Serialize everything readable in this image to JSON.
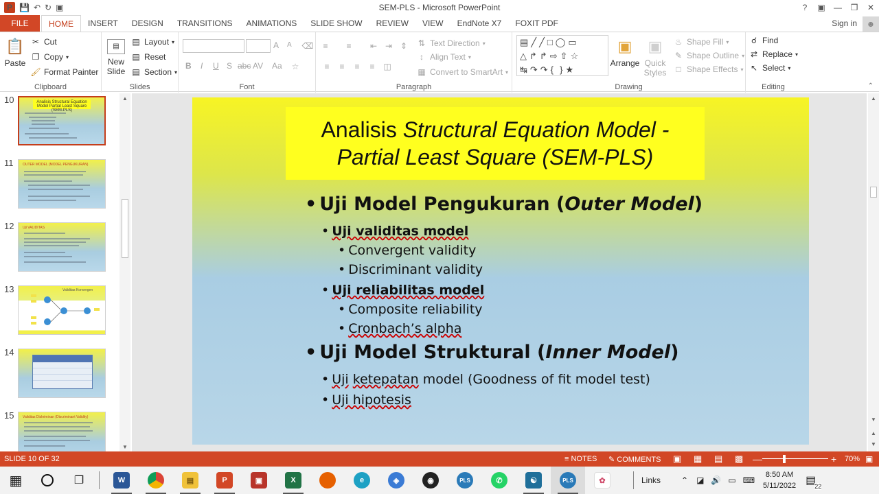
{
  "window": {
    "title": "SEM-PLS - Microsoft PowerPoint",
    "help": "?",
    "signin": "Sign in"
  },
  "tabs": [
    "FILE",
    "HOME",
    "INSERT",
    "DESIGN",
    "TRANSITIONS",
    "ANIMATIONS",
    "SLIDE SHOW",
    "REVIEW",
    "VIEW",
    "EndNote X7",
    "FOXIT PDF"
  ],
  "ribbon": {
    "clipboard": {
      "paste": "Paste",
      "cut": "Cut",
      "copy": "Copy",
      "format_painter": "Format Painter",
      "label": "Clipboard"
    },
    "slides": {
      "new_slide": "New Slide",
      "layout": "Layout",
      "reset": "Reset",
      "section": "Section",
      "label": "Slides"
    },
    "font": {
      "label": "Font",
      "bold": "B",
      "italic": "I",
      "underline": "U",
      "strike": "S",
      "abc": "abc",
      "av": "AV",
      "aa": "Aa",
      "grow": "A",
      "shrink": "A"
    },
    "paragraph": {
      "text_direction": "Text Direction",
      "align_text": "Align Text",
      "convert_smartart": "Convert to SmartArt",
      "label": "Paragraph"
    },
    "drawing": {
      "arrange": "Arrange",
      "quick_styles": "Quick Styles",
      "shape_fill": "Shape Fill",
      "shape_outline": "Shape Outline",
      "shape_effects": "Shape Effects",
      "label": "Drawing"
    },
    "editing": {
      "find": "Find",
      "replace": "Replace",
      "select": "Select",
      "label": "Editing"
    }
  },
  "thumbnails": [
    {
      "num": "10",
      "title": "Analisis Structural Equation Model Partial Least Square (SEM-PLS)",
      "selected": true
    },
    {
      "num": "11",
      "title": "OUTER MODEL (MODEL PENGUKURAN)",
      "selected": false
    },
    {
      "num": "12",
      "title": "Uji VALIDITAS",
      "selected": false
    },
    {
      "num": "13",
      "title": "Validitas Konvergen",
      "selected": false
    },
    {
      "num": "14",
      "title": "",
      "selected": false
    },
    {
      "num": "15",
      "title": "Validitas Diskriminan (Discriminant Validity)",
      "selected": false
    }
  ],
  "slide": {
    "title_line1_normal": "Analisis ",
    "title_line1_italic": "Structural Equation Model -",
    "title_line2_italic": "Partial Least Square (SEM-PLS)",
    "b1_prefix": "Uji Model Pengukuran (",
    "b1_italic": "Outer Model",
    "b1_suffix": ")",
    "b1_1": "Uji validitas model",
    "b1_1_a": "Convergent validity",
    "b1_1_b": "Discriminant validity",
    "b1_2": "Uji reliabilitas model",
    "b1_2_a": "Composite reliability",
    "b1_2_b": "Cronbach’s alpha",
    "b2_prefix": "Uji Model Struktural (",
    "b2_italic": "Inner Model",
    "b2_suffix": ")",
    "b2_1_a": "Uji",
    "b2_1_b": "ketepatan",
    "b2_1_c": " model (Goodness of fit model test)",
    "b2_2": "Uji hipotesis"
  },
  "status": {
    "slide_of": "SLIDE 10 OF 32",
    "notes": "NOTES",
    "comments": "COMMENTS",
    "zoom": "70%",
    "zoom_level": 0.7
  },
  "taskbar": {
    "links": "Links",
    "time": "8:50 AM",
    "date": "5/11/2022",
    "notif_count": "22"
  },
  "colors": {
    "accent": "#d24726",
    "slide_title_bg": "#ffff1f"
  }
}
